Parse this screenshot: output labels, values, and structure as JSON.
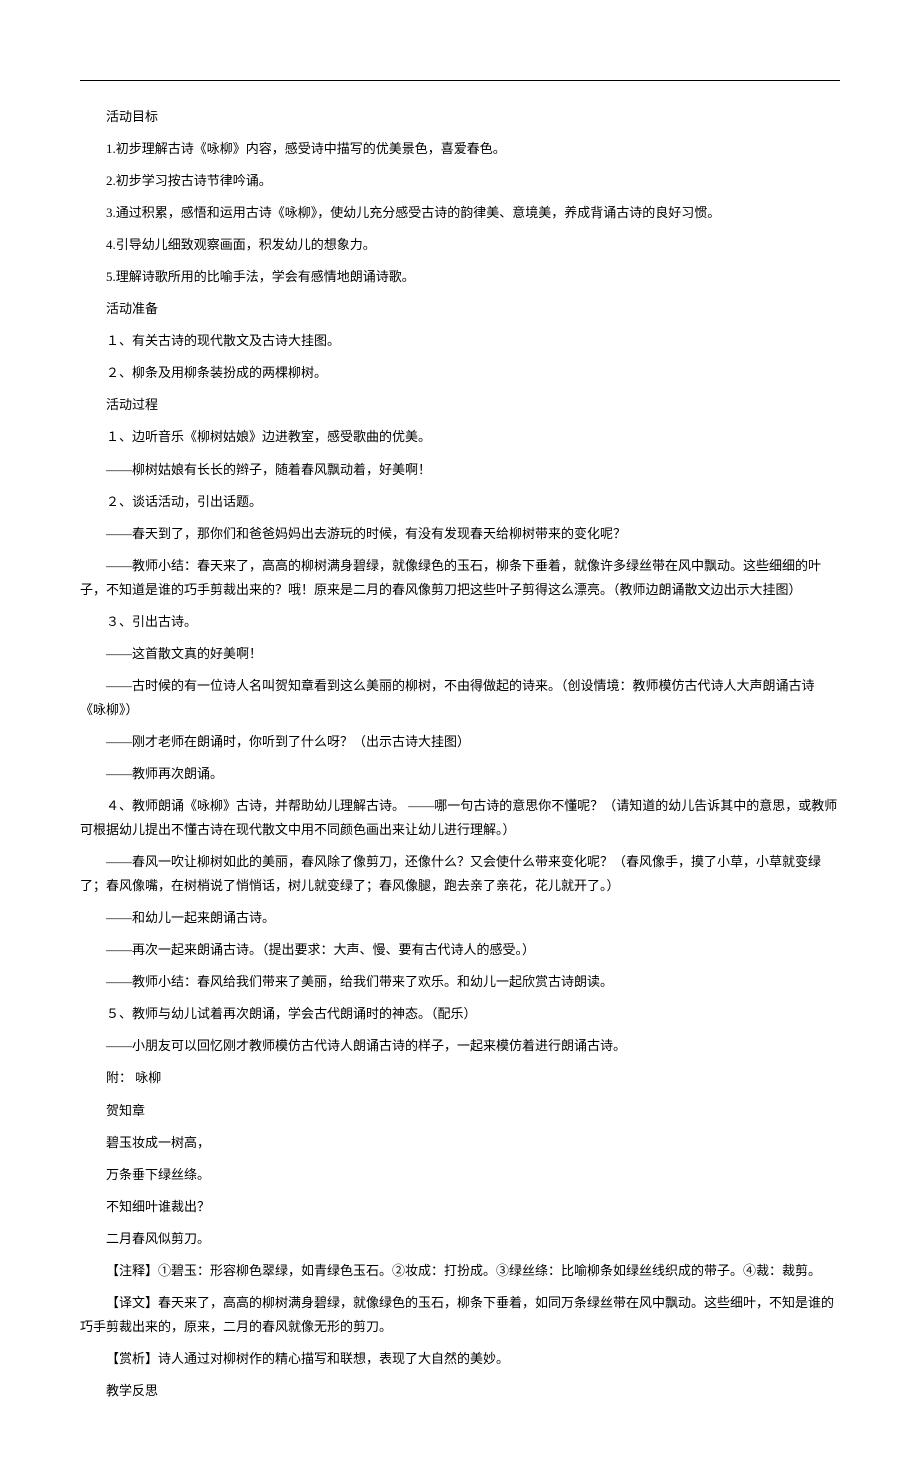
{
  "lines": [
    "活动目标",
    "1.初步理解古诗《咏柳》内容，感受诗中描写的优美景色，喜爱春色。",
    "2.初步学习按古诗节律吟诵。",
    "3.通过积累，感悟和运用古诗《咏柳》，使幼儿充分感受古诗的韵律美、意境美，养成背诵古诗的良好习惯。",
    "4.引导幼儿细致观察画面，积发幼儿的想象力。",
    "5.理解诗歌所用的比喻手法，学会有感情地朗诵诗歌。",
    "活动准备",
    "１、有关古诗的现代散文及古诗大挂图。",
    "２、柳条及用柳条装扮成的两棵柳树。",
    "活动过程",
    "１、边听音乐《柳树姑娘》边进教室，感受歌曲的优美。",
    "——柳树姑娘有长长的辫子，随着春风飘动着，好美啊！",
    "２、谈话活动，引出话题。",
    "——春天到了，那你们和爸爸妈妈出去游玩的时候，有没有发现春天给柳树带来的变化呢？",
    "——教师小结：春天来了，高高的柳树满身碧绿，就像绿色的玉石，柳条下垂着，就像许多绿丝带在风中飘动。这些细细的叶子，不知道是谁的巧手剪裁出来的？哦！原来是二月的春风像剪刀把这些叶子剪得这么漂亮。（教师边朗诵散文边出示大挂图）",
    "３、引出古诗。",
    "——这首散文真的好美啊！",
    "——古时候的有一位诗人名叫贺知章看到这么美丽的柳树，不由得做起的诗来。（创设情境：教师模仿古代诗人大声朗诵古诗《咏柳》）",
    "——刚才老师在朗诵时，你听到了什么呀？（出示古诗大挂图）",
    "——教师再次朗诵。",
    "４、教师朗诵《咏柳》古诗，并帮助幼儿理解古诗。 ——哪一句古诗的意思你不懂呢？（请知道的幼儿告诉其中的意思，或教师可根据幼儿提出不懂古诗在现代散文中用不同颜色画出来让幼儿进行理解。）",
    "——春风一吹让柳树如此的美丽，春风除了像剪刀，还像什么？又会使什么带来变化呢？（春风像手，摸了小草，小草就变绿了；春风像嘴，在树梢说了悄悄话，树儿就变绿了；春风像腿，跑去亲了亲花，花儿就开了。）",
    "——和幼儿一起来朗诵古诗。",
    "——再次一起来朗诵古诗。（提出要求：大声、慢、要有古代诗人的感受。）",
    "——教师小结：春风给我们带来了美丽，给我们带来了欢乐。和幼儿一起欣赏古诗朗读。",
    "５、教师与幼儿试着再次朗诵，学会古代朗诵时的神态。（配乐）",
    "——小朋友可以回忆刚才教师模仿古代诗人朗诵古诗的样子，一起来模仿着进行朗诵古诗。",
    "附： 咏柳",
    "贺知章",
    "碧玉妆成一树高，",
    "万条垂下绿丝绦。",
    "不知细叶谁裁出？",
    "二月春风似剪刀。",
    "【注释】①碧玉：形容柳色翠绿，如青绿色玉石。②妆成：打扮成。③绿丝绦：比喻柳条如绿丝线织成的带子。④裁：裁剪。",
    "【译文】春天来了，高高的柳树满身碧绿，就像绿色的玉石，柳条下垂着，如同万条绿丝带在风中飘动。这些细叶，不知是谁的巧手剪裁出来的，原来，二月的春风就像无形的剪刀。",
    "【赏析】诗人通过对柳树作的精心描写和联想，表现了大自然的美妙。",
    "教学反思"
  ]
}
